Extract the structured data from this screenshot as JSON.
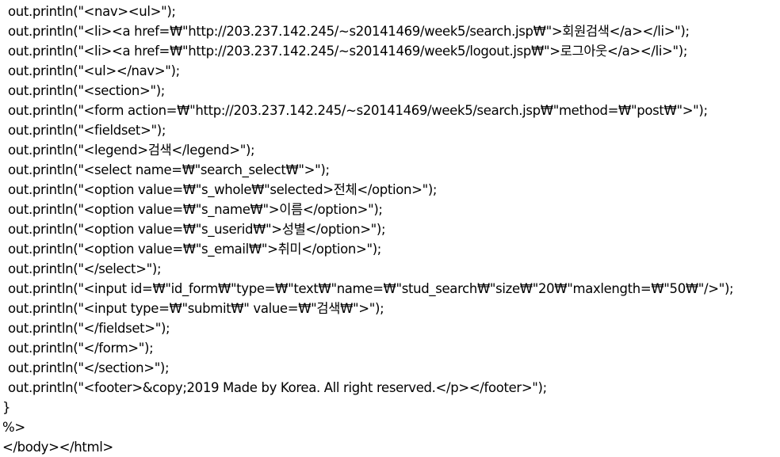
{
  "code": {
    "lines": [
      {
        "text": "out.println(\"<nav><ul>\");",
        "indent": true
      },
      {
        "text": "out.println(\"<li><a href=₩\"http://203.237.142.245/~s20141469/week5/search.jsp₩\">회원검색</a></li>\");",
        "indent": true
      },
      {
        "text": "out.println(\"<li><a href=₩\"http://203.237.142.245/~s20141469/week5/logout.jsp₩\">로그아웃</a></li>\");",
        "indent": true
      },
      {
        "text": "out.println(\"<ul></nav>\");",
        "indent": true
      },
      {
        "text": "out.println(\"<section>\");",
        "indent": true
      },
      {
        "text": "out.println(\"<form action=₩\"http://203.237.142.245/~s20141469/week5/search.jsp₩\"method=₩\"post₩\">\");",
        "indent": true
      },
      {
        "text": "out.println(\"<fieldset>\");",
        "indent": true
      },
      {
        "text": "out.println(\"<legend>검색</legend>\");",
        "indent": true
      },
      {
        "text": "out.println(\"<select name=₩\"search_select₩\">\");",
        "indent": true
      },
      {
        "text": "out.println(\"<option value=₩\"s_whole₩\"selected>전체</option>\");",
        "indent": true
      },
      {
        "text": "out.println(\"<option value=₩\"s_name₩\">이름</option>\");",
        "indent": true
      },
      {
        "text": "out.println(\"<option value=₩\"s_userid₩\">성별</option>\");",
        "indent": true
      },
      {
        "text": "out.println(\"<option value=₩\"s_email₩\">취미</option>\");",
        "indent": true
      },
      {
        "text": "out.println(\"</select>\");",
        "indent": true
      },
      {
        "text": "out.println(\"<input id=₩\"id_form₩\"type=₩\"text₩\"name=₩\"stud_search₩\"size₩\"20₩\"maxlength=₩\"50₩\"/>\");",
        "indent": true
      },
      {
        "text": "out.println(\"<input type=₩\"submit₩\" value=₩\"검색₩\">\");",
        "indent": true
      },
      {
        "text": "out.println(\"</fieldset>\");",
        "indent": true
      },
      {
        "text": "out.println(\"</form>\");",
        "indent": true
      },
      {
        "text": "out.println(\"</section>\");",
        "indent": true
      },
      {
        "text": "out.println(\"<footer>&copy;2019 Made by Korea. All right reserved.</p></footer>\");",
        "indent": true
      },
      {
        "text": "}",
        "indent": false
      },
      {
        "text": "%>",
        "indent": false
      },
      {
        "text": "</body></html>",
        "indent": false
      }
    ]
  }
}
